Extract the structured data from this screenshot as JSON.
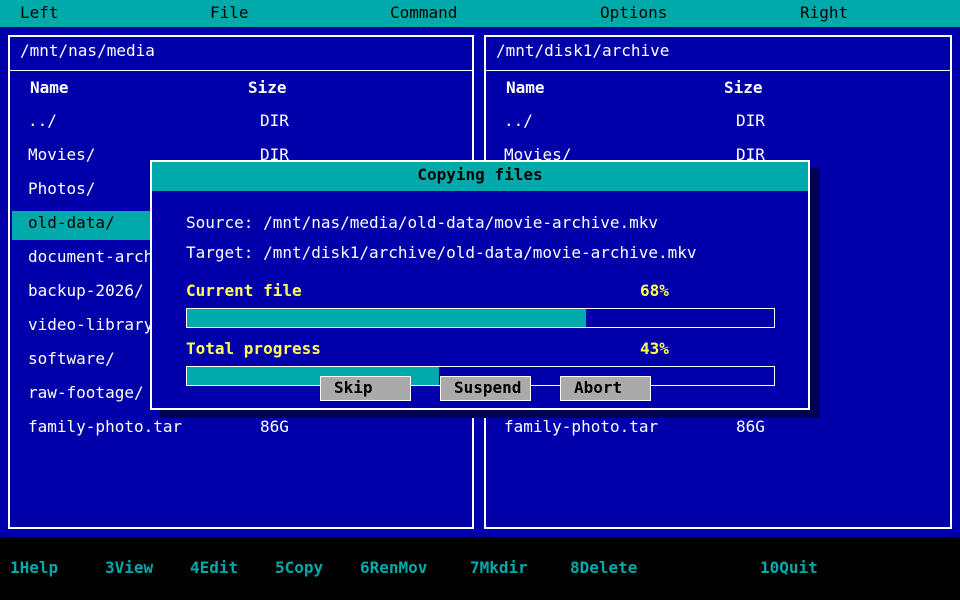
{
  "menu": [
    "Left",
    "File",
    "Command",
    "Options",
    "Right"
  ],
  "left_panel": {
    "path": "/mnt/nas/media",
    "headers": {
      "name": "Name",
      "size": "Size"
    },
    "rows": [
      {
        "name": "../",
        "size": "DIR"
      },
      {
        "name": "Movies/",
        "size": "DIR"
      },
      {
        "name": "Photos/",
        "size": ""
      },
      {
        "name": "old-data/",
        "size": ""
      },
      {
        "name": "document-arch",
        "size": ""
      },
      {
        "name": "backup-2026/",
        "size": ""
      },
      {
        "name": "video-library",
        "size": ""
      },
      {
        "name": "software/",
        "size": ""
      },
      {
        "name": "raw-footage/",
        "size": ""
      },
      {
        "name": "family-photo.tar",
        "size": "86G"
      }
    ],
    "selected_index": 3
  },
  "right_panel": {
    "path": "/mnt/disk1/archive",
    "headers": {
      "name": "Name",
      "size": "Size"
    },
    "rows": [
      {
        "name": "../",
        "size": "DIR"
      },
      {
        "name": "Movies/",
        "size": "DIR"
      },
      {
        "name": "family-photo.tar",
        "size": "86G"
      }
    ]
  },
  "dialog": {
    "title": "Copying files",
    "source": "Source: /mnt/nas/media/old-data/movie-archive.mkv",
    "target": "Target: /mnt/disk1/archive/old-data/movie-archive.mkv",
    "current_label": "Current file",
    "current_pct": "68%",
    "current_value": 0.68,
    "total_label": "Total progress",
    "total_pct": "43%",
    "total_value": 0.43,
    "buttons": {
      "skip": "Skip",
      "suspend": "Suspend",
      "abort": "Abort"
    }
  },
  "footer": [
    {
      "key": "1",
      "label": "Help"
    },
    {
      "key": "3",
      "label": "View"
    },
    {
      "key": "4",
      "label": "Edit"
    },
    {
      "key": "5",
      "label": "Copy"
    },
    {
      "key": "6",
      "label": "RenMov"
    },
    {
      "key": "7",
      "label": "Mkdir"
    },
    {
      "key": "8",
      "label": "Delete"
    },
    {
      "key": "10",
      "label": "Quit"
    }
  ],
  "colors": {
    "background": "#0000aa",
    "accent": "#00aaaa",
    "highlight_text": "#ffff55",
    "button": "#aaaaaa",
    "footer_background": "#000000"
  }
}
